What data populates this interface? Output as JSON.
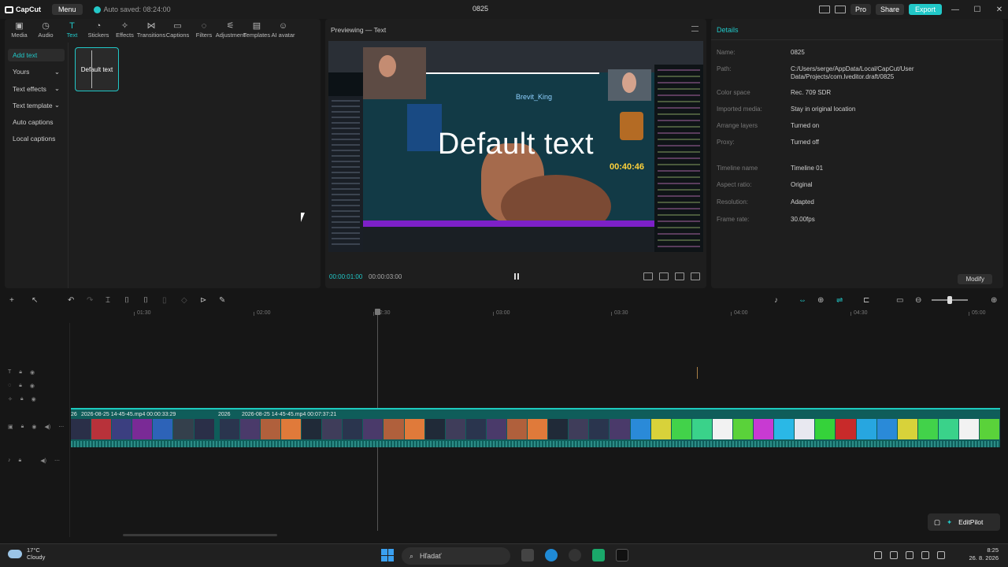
{
  "titlebar": {
    "app_name": "CapCut",
    "menu_label": "Menu",
    "autosave": "Auto saved: 08:24:00",
    "project_title": "0825",
    "pro_label": "Pro",
    "share_label": "Share",
    "export_label": "Export"
  },
  "toolbar": {
    "tools": [
      {
        "label": "Media",
        "icon": "media-icon",
        "glyph": "▣"
      },
      {
        "label": "Audio",
        "icon": "audio-icon",
        "glyph": "◷"
      },
      {
        "label": "Text",
        "icon": "text-icon",
        "glyph": "T"
      },
      {
        "label": "Stickers",
        "icon": "stickers-icon",
        "glyph": "◔"
      },
      {
        "label": "Effects",
        "icon": "effects-icon",
        "glyph": "✧"
      },
      {
        "label": "Transitions",
        "icon": "transitions-icon",
        "glyph": "⋈"
      },
      {
        "label": "Captions",
        "icon": "captions-icon",
        "glyph": "▭"
      },
      {
        "label": "Filters",
        "icon": "filters-icon",
        "glyph": "◌"
      },
      {
        "label": "Adjustment",
        "icon": "adjustment-icon",
        "glyph": "⚟"
      },
      {
        "label": "Templates",
        "icon": "templates-icon",
        "glyph": "▤"
      },
      {
        "label": "AI avatar",
        "icon": "ai-avatar-icon",
        "glyph": "☺"
      }
    ],
    "active": "Text"
  },
  "text_panel": {
    "categories": [
      "Add text",
      "Yours",
      "Text effects",
      "Text template",
      "Auto captions",
      "Local captions"
    ],
    "default_card": "Default text"
  },
  "preview": {
    "title": "Previewing — Text",
    "overlay_text": "Default text",
    "stream_nick": "Brevit_King",
    "stream_timer": "00:40:46",
    "time_current": "00:00:01:00",
    "time_total": "00:00:03:00"
  },
  "details": {
    "title": "Details",
    "rows": [
      {
        "k": "Name:",
        "v": "0825"
      },
      {
        "k": "Path:",
        "v": "C:/Users/serge/AppData/Local/CapCut/User Data/Projects/com.lveditor.draft/0825"
      },
      {
        "k": "Color space",
        "v": "Rec. 709 SDR"
      },
      {
        "k": "Imported media:",
        "v": "Stay in original location"
      },
      {
        "k": "Arrange layers",
        "v": "Turned on"
      },
      {
        "k": "Proxy:",
        "v": "Turned off"
      },
      {
        "k": "Timeline name",
        "v": "Timeline 01"
      },
      {
        "k": "Aspect ratio:",
        "v": "Original"
      },
      {
        "k": "Resolution:",
        "v": "Adapted"
      },
      {
        "k": "Frame rate:",
        "v": "30.00fps"
      }
    ],
    "modify_label": "Modify"
  },
  "timeline": {
    "ruler": [
      "01:30",
      "02:00",
      "02:30",
      "03:00",
      "03:30",
      "04:00",
      "04:30",
      "05:00"
    ],
    "clip1_label": "2026-08-25 14-45-45.mp4   00:00:33:29",
    "clip1_prefix": "26",
    "clip2_prefix": "2026",
    "clip2_label": "2026-08-25 14-45-45.mp4   00:07:37:21",
    "editpilot_label": "EditPilot"
  },
  "taskbar": {
    "temperature": "17°C",
    "weather": "Cloudy",
    "search_placeholder": "Hľadať",
    "time": "8:25",
    "date": "26. 8. 2026"
  },
  "colors": {
    "accent": "#21c8c8",
    "clip": "#0f5d5a"
  }
}
